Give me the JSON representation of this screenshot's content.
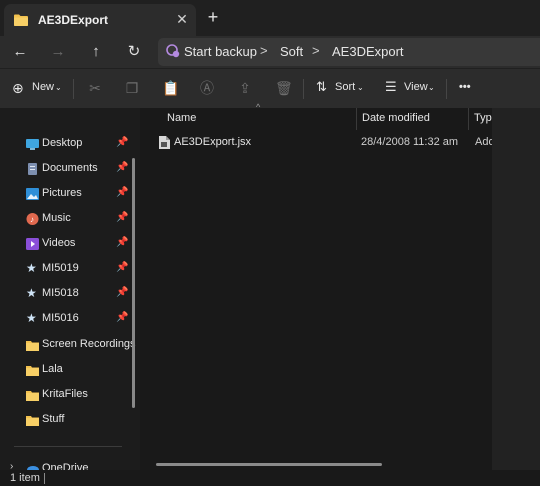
{
  "tab": {
    "title": "AE3DExport",
    "close": "✕",
    "new": "+"
  },
  "nav": {
    "back": "←",
    "forward": "→",
    "up": "↑",
    "refresh": "↻"
  },
  "address": {
    "crumbs": [
      "Start backup",
      "Soft",
      "AE3DExport"
    ],
    "separator": ">"
  },
  "commands": {
    "new_label": "New",
    "sort_label": "Sort",
    "view_label": "View",
    "more_label": "•••"
  },
  "sidebar": {
    "items": [
      {
        "label": "Desktop",
        "icon": "desktop-icon",
        "pinned": true
      },
      {
        "label": "Documents",
        "icon": "documents-icon",
        "pinned": true
      },
      {
        "label": "Pictures",
        "icon": "pictures-icon",
        "pinned": true
      },
      {
        "label": "Music",
        "icon": "music-icon",
        "pinned": true
      },
      {
        "label": "Videos",
        "icon": "videos-icon",
        "pinned": true
      },
      {
        "label": "MI5019",
        "icon": "star-icon",
        "pinned": true
      },
      {
        "label": "MI5018",
        "icon": "star-icon",
        "pinned": true
      },
      {
        "label": "MI5016",
        "icon": "star-icon",
        "pinned": true
      },
      {
        "label": "Screen Recordings",
        "icon": "folder-icon",
        "pinned": false
      },
      {
        "label": "Lala",
        "icon": "folder-icon",
        "pinned": false
      },
      {
        "label": "KritaFiles",
        "icon": "folder-icon",
        "pinned": false
      },
      {
        "label": "Stuff",
        "icon": "folder-icon",
        "pinned": false
      }
    ],
    "onedrive_label": "OneDrive"
  },
  "columns": {
    "name": "Name",
    "date": "Date modified",
    "type": "Type"
  },
  "files": [
    {
      "name": "AE3DExport.jsx",
      "date": "28/4/2008 11:32 am",
      "type": "Adobe"
    }
  ],
  "status": {
    "count": "1 item"
  },
  "colors": {
    "folder": "#f2c14e",
    "accent": "#b48ae0"
  }
}
